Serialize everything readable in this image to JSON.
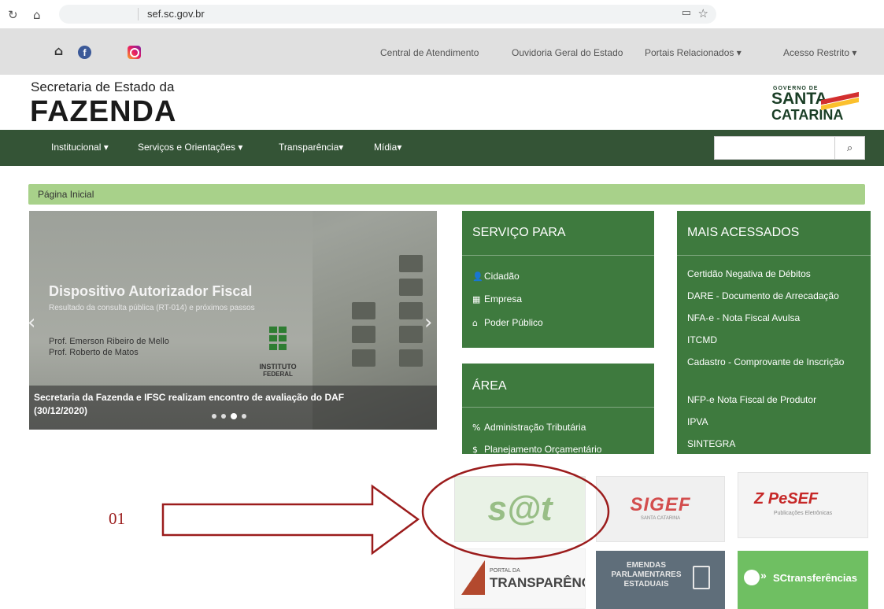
{
  "browser": {
    "url": "sef.sc.gov.br",
    "reload_icon": "reload-icon",
    "home_icon": "home-icon",
    "bookmark_icon": "reader-icon",
    "star_icon": "star-icon"
  },
  "topbar": {
    "social": [
      "home-icon",
      "facebook-icon",
      "instagram-icon"
    ],
    "links": [
      "Central de Atendimento",
      "Ouvidoria Geral do Estado",
      "Portais Relacionados",
      "Acesso Restrito"
    ]
  },
  "header": {
    "subtitle": "Secretaria de Estado da",
    "title": "FAZENDA",
    "gov_line1": "GOVERNO DE",
    "gov_line2": "SANTA",
    "gov_line3": "CATARINA"
  },
  "nav": {
    "items": [
      "Institucional",
      "Serviços e Orientações",
      "Transparência",
      "Mídia"
    ],
    "search_placeholder": "",
    "search_icon": "search-icon"
  },
  "breadcrumb": "Página Inicial",
  "carousel": {
    "slide_title": "Dispositivo Autorizador Fiscal",
    "slide_subtitle": "Resultado da consulta pública (RT-014) e próximos passos",
    "slide_person1": "Prof. Emerson Ribeiro de Mello",
    "slide_person2": "Prof. Roberto de Matos",
    "slide_logo1": "INSTITUTO",
    "slide_logo2": "FEDERAL",
    "caption_line1": "Secretaria da Fazenda e IFSC realizam encontro de avaliação do DAF",
    "caption_line2": "(30/12/2020)",
    "dots": 4,
    "active_dot": 3
  },
  "servico": {
    "title": "SERVIÇO PARA",
    "items": [
      {
        "label": "Cidadão",
        "icon": "user-icon"
      },
      {
        "label": "Empresa",
        "icon": "building-icon"
      },
      {
        "label": "Poder Público",
        "icon": "institution-icon"
      }
    ]
  },
  "area": {
    "title": "ÁREA",
    "items": [
      {
        "label": "Administração Tributária",
        "icon": "percent-icon"
      },
      {
        "label": "Planejamento Orçamentário",
        "icon": "budget-icon"
      }
    ]
  },
  "mais": {
    "title": "MAIS ACESSADOS",
    "items": [
      "Certidão Negativa de Débitos",
      "DARE - Documento de Arrecadação",
      "NFA-e - Nota Fiscal Avulsa",
      "ITCMD",
      "Cadastro - Comprovante de Inscrição",
      "NFP-e Nota Fiscal de Produtor",
      "IPVA",
      "SINTEGRA"
    ]
  },
  "tiles": {
    "sat": "s@t",
    "sigef": "SIGEF",
    "sigef_sub": "SANTA CATARINA",
    "pesef": "PeSEF",
    "pesef_sub": "Publicações Eletrônicas",
    "transp_sub": "PORTAL DA",
    "transp": "TRANSPARÊNCIA",
    "emendas_line1": "EMENDAS",
    "emendas_line2": "PARLAMENTARES",
    "emendas_line3": "ESTADUAIS",
    "sctr": "SCtransferências"
  },
  "annotation": {
    "label": "01",
    "color": "#9b1c1c"
  },
  "colors": {
    "nav_green": "#345436",
    "box_green": "#3e7a3e",
    "crumb_green": "#a8d18a"
  }
}
